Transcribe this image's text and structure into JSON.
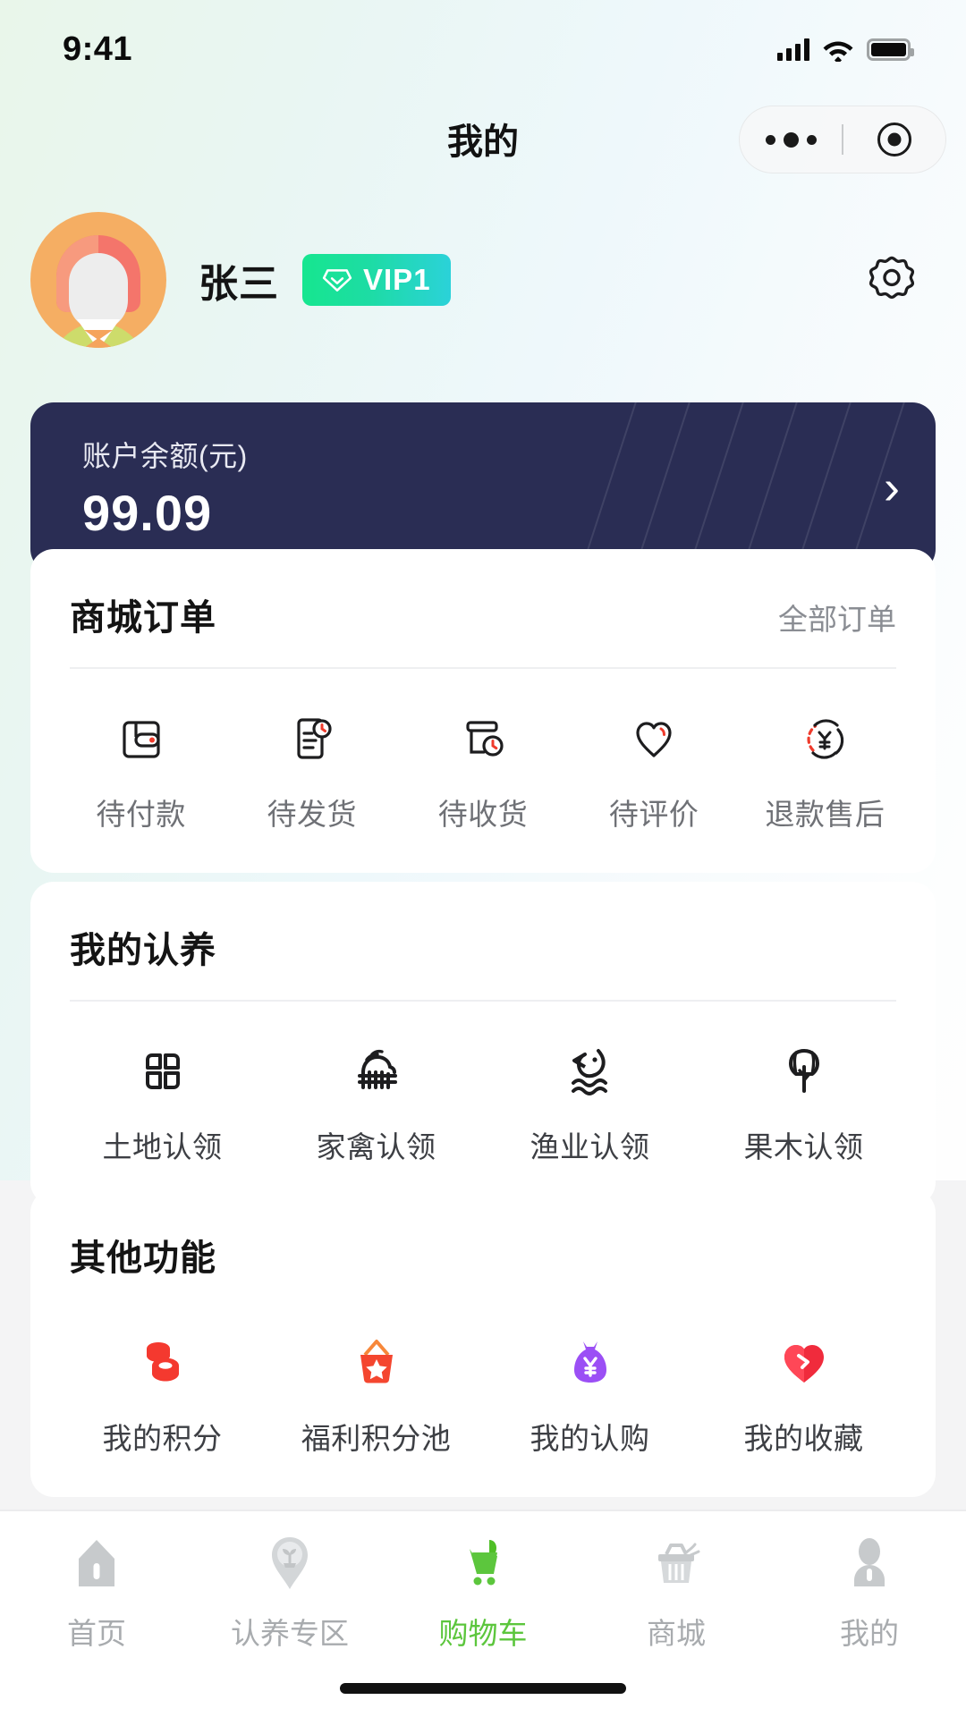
{
  "status_bar": {
    "time": "9:41",
    "signal_icon": "cellular-signal-icon",
    "wifi_icon": "wifi-icon",
    "battery_icon": "battery-icon"
  },
  "nav": {
    "title": "我的",
    "capsule": {
      "menu_icon": "more-dots-icon",
      "target_icon": "target-circle-icon"
    }
  },
  "profile": {
    "avatar_alt": "user-avatar",
    "name": "张三",
    "vip": {
      "label": "VIP1",
      "icon": "diamond-icon",
      "color_start": "#16e68f",
      "color_end": "#2bd2d9"
    },
    "settings_icon": "gear-icon"
  },
  "balance": {
    "label": "账户余额(元)",
    "value": "99.09",
    "arrow": "›",
    "background": "#2a2d54"
  },
  "orders": {
    "title": "商城订单",
    "more": "全部订单",
    "items": [
      {
        "label": "待付款",
        "icon": "wallet-icon"
      },
      {
        "label": "待发货",
        "icon": "document-clock-icon"
      },
      {
        "label": "待收货",
        "icon": "box-clock-icon"
      },
      {
        "label": "待评价",
        "icon": "heart-outline-icon"
      },
      {
        "label": "退款售后",
        "icon": "refund-yuan-icon"
      }
    ]
  },
  "adoption": {
    "title": "我的认养",
    "items": [
      {
        "label": "土地认领",
        "icon": "land-grid-icon"
      },
      {
        "label": "家禽认领",
        "icon": "poultry-icon"
      },
      {
        "label": "渔业认领",
        "icon": "fish-icon"
      },
      {
        "label": "果木认领",
        "icon": "tree-icon"
      }
    ]
  },
  "other": {
    "title": "其他功能",
    "items": [
      {
        "label": "我的积分",
        "icon": "coins-icon",
        "color": "#f4392f"
      },
      {
        "label": "福利积分池",
        "icon": "basket-star-icon",
        "color": "#f4522f"
      },
      {
        "label": "我的认购",
        "icon": "money-bag-yuan-icon",
        "color": "#9b4ff5"
      },
      {
        "label": "我的收藏",
        "icon": "heart-filled-icon",
        "color": "#f02b3c"
      }
    ]
  },
  "tabbar": {
    "active_color": "#5cc63d",
    "inactive_color": "#c7cacc",
    "items": [
      {
        "label": "首页",
        "icon": "home-icon",
        "active": false
      },
      {
        "label": "认养专区",
        "icon": "sprout-badge-icon",
        "active": false
      },
      {
        "label": "购物车",
        "icon": "shopping-cart-icon",
        "active": true
      },
      {
        "label": "商城",
        "icon": "store-basket-icon",
        "active": false
      },
      {
        "label": "我的",
        "icon": "person-icon",
        "active": false
      }
    ]
  }
}
